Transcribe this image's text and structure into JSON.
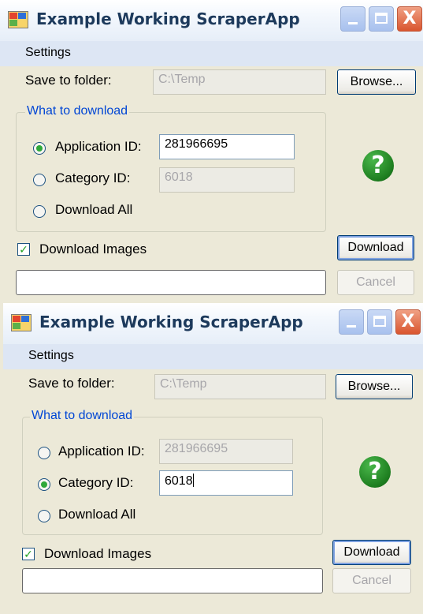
{
  "windows": [
    {
      "title": "Example Working ScraperApp",
      "menu": [
        "Settings"
      ],
      "save_folder_label": "Save to folder:",
      "save_folder_value": "C:\\Temp",
      "browse_label": "Browse...",
      "group_title": "What to download",
      "app_id_label": "Application ID:",
      "app_id_value": "281966695",
      "cat_id_label": "Category ID:",
      "cat_id_value": "6018",
      "download_all_label": "Download All",
      "download_images_label": "Download Images",
      "download_button": "Download",
      "cancel_button": "Cancel",
      "help_glyph": "?",
      "selected_option": "application_id",
      "download_images_checked": true
    },
    {
      "title": "Example Working ScraperApp",
      "menu": [
        "Settings"
      ],
      "save_folder_label": "Save to folder:",
      "save_folder_value": "C:\\Temp",
      "browse_label": "Browse...",
      "group_title": "What to download",
      "app_id_label": "Application ID:",
      "app_id_value": "281966695",
      "cat_id_label": "Category ID:",
      "cat_id_value": "6018",
      "download_all_label": "Download All",
      "download_images_label": "Download Images",
      "download_button": "Download",
      "cancel_button": "Cancel",
      "help_glyph": "?",
      "selected_option": "category_id",
      "download_images_checked": true
    }
  ],
  "caption_glyphs": {
    "close": "X",
    "checkmark": "✓"
  },
  "colors": {
    "window_bg": "#ece9d8",
    "menubar_bg": "#dde6f4",
    "group_title": "#0046d5",
    "help_green": "#1d7d1f",
    "close_button": "#d9552f"
  }
}
